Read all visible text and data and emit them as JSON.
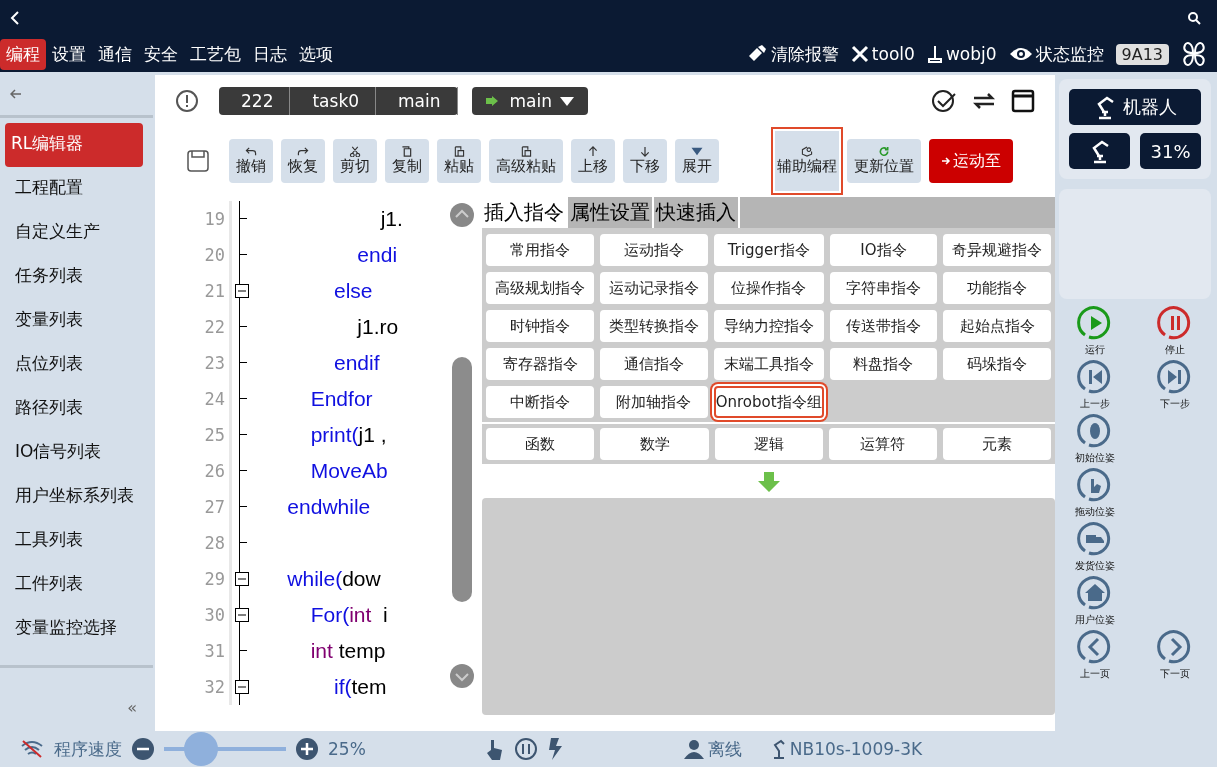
{
  "menu": [
    {
      "label": "编程",
      "selected": true
    },
    {
      "label": "设置",
      "selected": false
    },
    {
      "label": "通信",
      "selected": false
    },
    {
      "label": "安全",
      "selected": false
    },
    {
      "label": "工艺包",
      "selected": false
    },
    {
      "label": "日志",
      "selected": false
    },
    {
      "label": "选项",
      "selected": false
    }
  ],
  "top_actions": {
    "clear_alarm": "清除报警",
    "tool": "tool0",
    "wobj": "wobj0",
    "monitor": "状态监控",
    "code": "9A13"
  },
  "sidebar": {
    "items": [
      {
        "label": "RL编辑器",
        "selected": true
      },
      {
        "label": "工程配置",
        "selected": false
      },
      {
        "label": "自定义生产",
        "selected": false
      },
      {
        "label": "任务列表",
        "selected": false
      },
      {
        "label": "变量列表",
        "selected": false
      },
      {
        "label": "点位列表",
        "selected": false
      },
      {
        "label": "路径列表",
        "selected": false
      },
      {
        "label": "IO信号列表",
        "selected": false
      },
      {
        "label": "用户坐标系列表",
        "selected": false
      },
      {
        "label": "工具列表",
        "selected": false
      },
      {
        "label": "工件列表",
        "selected": false
      },
      {
        "label": "变量监控选择",
        "selected": false
      }
    ],
    "collapse": "«"
  },
  "breadcrumb": [
    "222",
    "task0",
    "main"
  ],
  "run_selector": {
    "value": "main"
  },
  "toolbar": [
    {
      "label": "撤销",
      "kind": "normal",
      "highlighted": false
    },
    {
      "label": "恢复",
      "kind": "normal",
      "highlighted": false
    },
    {
      "label": "剪切",
      "kind": "normal",
      "highlighted": false
    },
    {
      "label": "复制",
      "kind": "normal",
      "highlighted": false
    },
    {
      "label": "粘贴",
      "kind": "normal",
      "highlighted": false
    },
    {
      "label": "高级粘贴",
      "kind": "normal",
      "highlighted": false
    },
    {
      "label": "上移",
      "kind": "normal",
      "highlighted": false
    },
    {
      "label": "下移",
      "kind": "normal",
      "highlighted": false
    },
    {
      "label": "展开",
      "kind": "normal",
      "highlighted": false
    },
    {
      "label": "辅助编程",
      "kind": "normal",
      "highlighted": true
    },
    {
      "label": "更新位置",
      "kind": "normal",
      "highlighted": false
    },
    {
      "label": "运动至",
      "kind": "primary",
      "highlighted": false
    }
  ],
  "code": [
    {
      "number": "19",
      "fold": false,
      "tokens": [
        {
          "text": "                    j1.",
          "kind": "plain"
        }
      ]
    },
    {
      "number": "20",
      "fold": false,
      "tokens": [
        {
          "text": "                endi",
          "kind": "keyword"
        }
      ]
    },
    {
      "number": "21",
      "fold": true,
      "tokens": [
        {
          "text": "            else",
          "kind": "keyword"
        }
      ]
    },
    {
      "number": "22",
      "fold": false,
      "tokens": [
        {
          "text": "                j1.ro",
          "kind": "plain"
        }
      ]
    },
    {
      "number": "23",
      "fold": false,
      "tokens": [
        {
          "text": "            endif",
          "kind": "keyword"
        }
      ]
    },
    {
      "number": "24",
      "fold": false,
      "tokens": [
        {
          "text": "        Endfor",
          "kind": "keyword"
        }
      ]
    },
    {
      "number": "25",
      "fold": false,
      "tokens": [
        {
          "text": "        print(",
          "kind": "keyword"
        },
        {
          "text": "j1 ,",
          "kind": "plain"
        }
      ]
    },
    {
      "number": "26",
      "fold": false,
      "tokens": [
        {
          "text": "        MoveAb",
          "kind": "keyword"
        }
      ]
    },
    {
      "number": "27",
      "fold": false,
      "tokens": [
        {
          "text": "    endwhile",
          "kind": "keyword"
        }
      ]
    },
    {
      "number": "28",
      "fold": false
    },
    {
      "number": "29",
      "fold": true,
      "tokens": [
        {
          "text": "    while(",
          "kind": "keyword"
        },
        {
          "text": "dow",
          "kind": "plain"
        }
      ]
    },
    {
      "number": "30",
      "fold": true,
      "tokens": [
        {
          "text": "        For(",
          "kind": "keyword"
        },
        {
          "text": "int",
          "kind": "type"
        },
        {
          "text": "  i",
          "kind": "plain"
        }
      ]
    },
    {
      "number": "31",
      "fold": false,
      "tokens": [
        {
          "text": "        int",
          "kind": "type"
        },
        {
          "text": " temp",
          "kind": "plain"
        }
      ]
    },
    {
      "number": "32",
      "fold": true,
      "tokens": [
        {
          "text": "            if(",
          "kind": "keyword"
        },
        {
          "text": "tem",
          "kind": "plain"
        }
      ]
    }
  ],
  "insert_panel": {
    "tabs": [
      {
        "label": "插入指令",
        "selected": true
      },
      {
        "label": "属性设置",
        "selected": false
      },
      {
        "label": "快速插入",
        "selected": false
      }
    ],
    "commands": [
      {
        "label": "常用指令",
        "highlighted": false
      },
      {
        "label": "运动指令",
        "highlighted": false
      },
      {
        "label": "Trigger指令",
        "highlighted": false
      },
      {
        "label": "IO指令",
        "highlighted": false
      },
      {
        "label": "奇异规避指令",
        "highlighted": false
      },
      {
        "label": "高级规划指令",
        "highlighted": false
      },
      {
        "label": "运动记录指令",
        "highlighted": false
      },
      {
        "label": "位操作指令",
        "highlighted": false
      },
      {
        "label": "字符串指令",
        "highlighted": false
      },
      {
        "label": "功能指令",
        "highlighted": false
      },
      {
        "label": "时钟指令",
        "highlighted": false
      },
      {
        "label": "类型转换指令",
        "highlighted": false
      },
      {
        "label": "导纳力控指令",
        "highlighted": false
      },
      {
        "label": "传送带指令",
        "highlighted": false
      },
      {
        "label": "起始点指令",
        "highlighted": false
      },
      {
        "label": "寄存器指令",
        "highlighted": false
      },
      {
        "label": "通信指令",
        "highlighted": false
      },
      {
        "label": "末端工具指令",
        "highlighted": false
      },
      {
        "label": "料盘指令",
        "highlighted": false
      },
      {
        "label": "码垛指令",
        "highlighted": false
      },
      {
        "label": "中断指令",
        "highlighted": false
      },
      {
        "label": "附加轴指令",
        "highlighted": false
      },
      {
        "label": "Onrobot指令组",
        "highlighted": true
      }
    ],
    "categories": [
      "函数",
      "数学",
      "逻辑",
      "运算符",
      "元素"
    ]
  },
  "robot_panel": {
    "title": "机器人",
    "speed": "31%"
  },
  "controls": [
    {
      "label": "运行",
      "color": "#1a9a1a"
    },
    {
      "label": "停止",
      "color": "#cc2b2b"
    },
    {
      "label": "上一步",
      "color": "#4a6a8a"
    },
    {
      "label": "下一步",
      "color": "#4a6a8a"
    },
    {
      "label": "初始位姿",
      "color": "#4a6a8a"
    },
    {
      "label": "拖动位姿",
      "color": "#4a6a8a"
    },
    {
      "label": "发货位姿",
      "color": "#4a6a8a"
    },
    {
      "label": "用户位姿",
      "color": "#4a6a8a"
    },
    {
      "label": "上一页",
      "color": "#4a6a8a"
    },
    {
      "label": "下一页",
      "color": "#4a6a8a"
    }
  ],
  "status_bar": {
    "speed_label": "程序速度",
    "level": 0.3,
    "speed": "25%",
    "mode": "离线",
    "device": "NB10s-1009-3K"
  }
}
